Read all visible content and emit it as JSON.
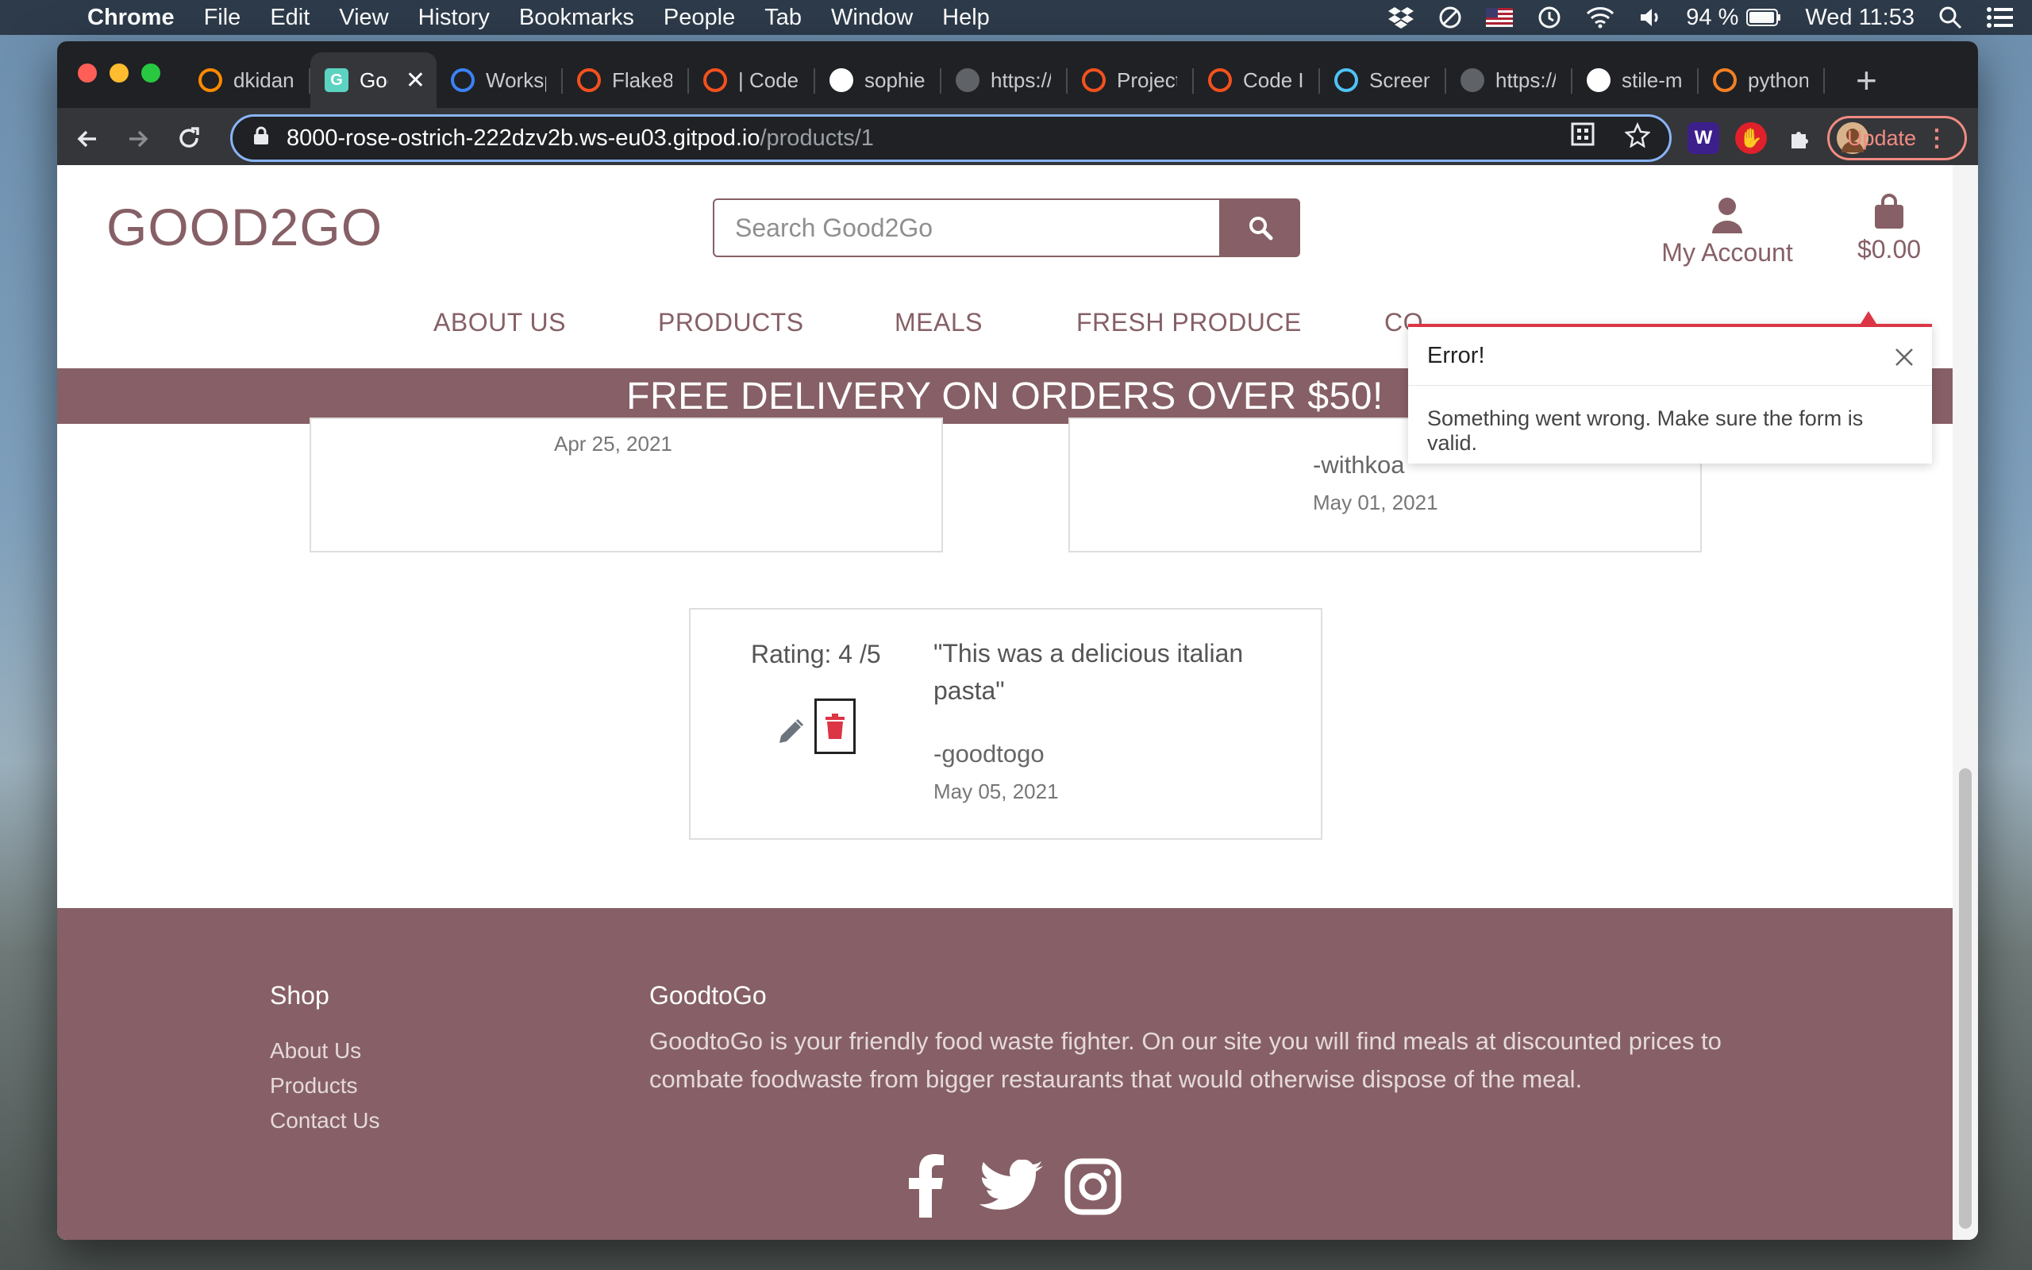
{
  "os_menubar": {
    "app": "Chrome",
    "menus": [
      "File",
      "Edit",
      "View",
      "History",
      "Bookmarks",
      "People",
      "Tab",
      "Window",
      "Help"
    ],
    "battery": "94 %",
    "clock": "Wed 11:53"
  },
  "browser": {
    "tabs": [
      {
        "title": "dkidan",
        "favicon": "gitpod-icon",
        "color": "#ff8a00"
      },
      {
        "title": "Goo",
        "favicon": "site-g-icon",
        "color": "#5bd3c0",
        "active": true
      },
      {
        "title": "Worksp",
        "favicon": "hexagon-icon",
        "color": "#3b82f6"
      },
      {
        "title": "Flake8",
        "favicon": "ring-icon",
        "color": "#f4511e"
      },
      {
        "title": "| Code",
        "favicon": "ring-icon",
        "color": "#f4511e"
      },
      {
        "title": "sophie",
        "favicon": "github-icon",
        "color": "#ffffff"
      },
      {
        "title": "https://",
        "favicon": "globe-icon",
        "color": "#9aa0a6"
      },
      {
        "title": "Project",
        "favicon": "ring-icon",
        "color": "#f4511e"
      },
      {
        "title": "Code In",
        "favicon": "ring-icon",
        "color": "#f4511e"
      },
      {
        "title": "Screen",
        "favicon": "gear-icon",
        "color": "#4fc3f7"
      },
      {
        "title": "https://",
        "favicon": "globe-icon",
        "color": "#9aa0a6"
      },
      {
        "title": "stile-m",
        "favicon": "github-icon",
        "color": "#ffffff"
      },
      {
        "title": "python",
        "favicon": "stack-icon",
        "color": "#f48024"
      }
    ],
    "url_host": "8000-rose-ostrich-222dzv2b.ws-eu03.gitpod.io",
    "url_path": "/products/1",
    "update_label": "Update"
  },
  "site": {
    "logo": "GOOD2GO",
    "search_placeholder": "Search Good2Go",
    "account_label": "My Account",
    "bag_total": "$0.00",
    "nav": [
      "ABOUT US",
      "PRODUCTS",
      "MEALS",
      "FRESH PRODUCE",
      "CO"
    ],
    "banner": "FREE DELIVERY ON ORDERS OVER $50!"
  },
  "toast": {
    "title": "Error!",
    "message": "Something went wrong. Make sure the form is valid."
  },
  "reviews": {
    "left_date": "Apr 25, 2021",
    "right_author": "-withkoa",
    "right_date": "May 01, 2021",
    "current": {
      "rating": "Rating: 4 /5",
      "quote": "\"This was a delicious italian pasta\"",
      "author": "-goodtogo",
      "date": "May 05, 2021"
    }
  },
  "footer": {
    "shop_heading": "Shop",
    "shop_links": [
      "About Us",
      "Products",
      "Contact Us"
    ],
    "about_heading": "GoodtoGo",
    "about_text": "GoodtoGo is your friendly food waste fighter. On our site you will find meals at discounted prices to combate foodwaste from bigger restaurants that would otherwise dispose of the meal."
  },
  "colors": {
    "brand": "#866066",
    "error": "#dc3545"
  }
}
